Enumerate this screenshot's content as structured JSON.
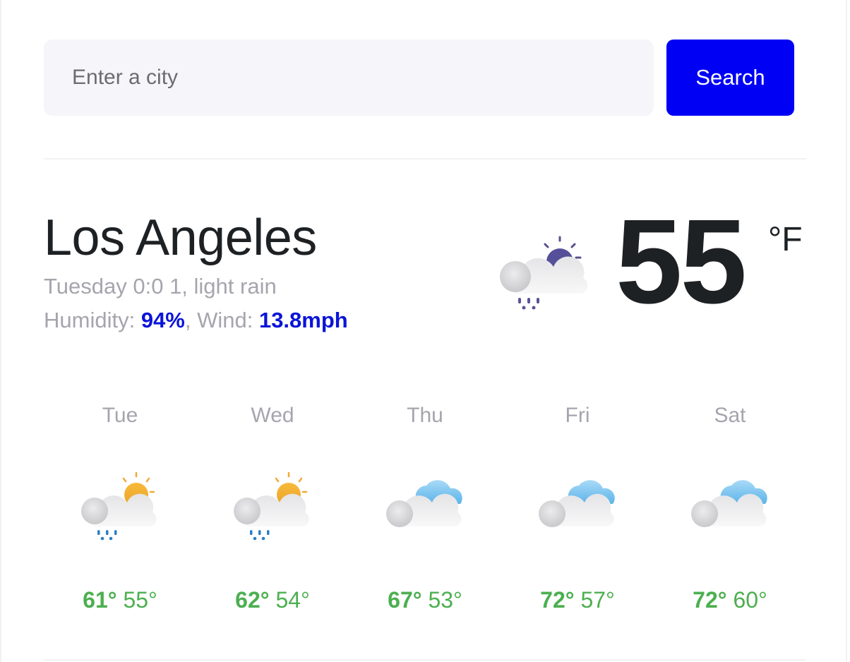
{
  "search": {
    "placeholder": "Enter a city",
    "value": "",
    "button_label": "Search"
  },
  "current": {
    "city": "Los Angeles",
    "datetime_condition": "Tuesday 0:0 1, light rain",
    "humidity_label": "Humidity: ",
    "humidity_value": "94%",
    "wind_label": ", Wind: ",
    "wind_value": "13.8mph",
    "temperature": "55",
    "unit": "°F",
    "icon": "cloud-sun-rain-icon"
  },
  "colors": {
    "accent": "#0000f5",
    "value_blue": "#0a14d8",
    "temp_green": "#4caf50",
    "muted": "#a5a5ae"
  },
  "forecast": [
    {
      "day": "Tue",
      "high": "61°",
      "low": "55°",
      "icon": "cloud-sun-rain-icon"
    },
    {
      "day": "Wed",
      "high": "62°",
      "low": "54°",
      "icon": "cloud-sun-rain-icon"
    },
    {
      "day": "Thu",
      "high": "67°",
      "low": "53°",
      "icon": "clouds-icon"
    },
    {
      "day": "Fri",
      "high": "72°",
      "low": "57°",
      "icon": "clouds-icon"
    },
    {
      "day": "Sat",
      "high": "72°",
      "low": "60°",
      "icon": "clouds-icon"
    }
  ]
}
